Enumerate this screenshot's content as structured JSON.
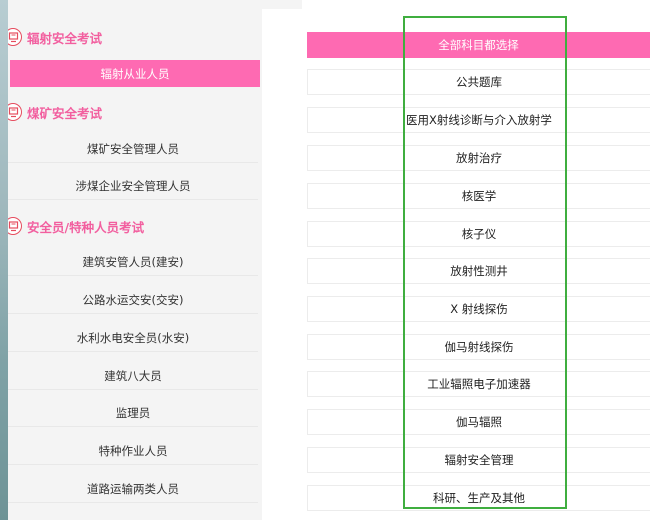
{
  "colors": {
    "accent": "#fe6ab2",
    "category_text": "#f25f9f",
    "icon": "#e64c5e",
    "highlight": "#3fae3f"
  },
  "sidebar": {
    "categories": [
      {
        "title": "辐射安全考试",
        "icon": "certificate-icon",
        "items": [
          "辐射从业人员"
        ]
      },
      {
        "title": "煤矿安全考试",
        "icon": "certificate-icon",
        "items": [
          "煤矿安全管理人员",
          "涉煤企业安全管理人员"
        ]
      },
      {
        "title": "安全员/特种人员考试",
        "icon": "certificate-icon",
        "items": [
          "建筑安管人员(建安)",
          "公路水运交安(交安)",
          "水利水电安全员(水安)",
          "建筑八大员",
          "监理员",
          "特种作业人员",
          "道路运输两类人员"
        ]
      }
    ],
    "active_item": "辐射从业人员"
  },
  "subjects": {
    "header": "全部科目都选择",
    "items": [
      "公共题库",
      "医用X射线诊断与介入放射学",
      "放射治疗",
      "核医学",
      "核子仪",
      "放射性测井",
      "X 射线探伤",
      "伽马射线探伤",
      "工业辐照电子加速器",
      "伽马辐照",
      "辐射安全管理",
      "科研、生产及其他"
    ]
  }
}
